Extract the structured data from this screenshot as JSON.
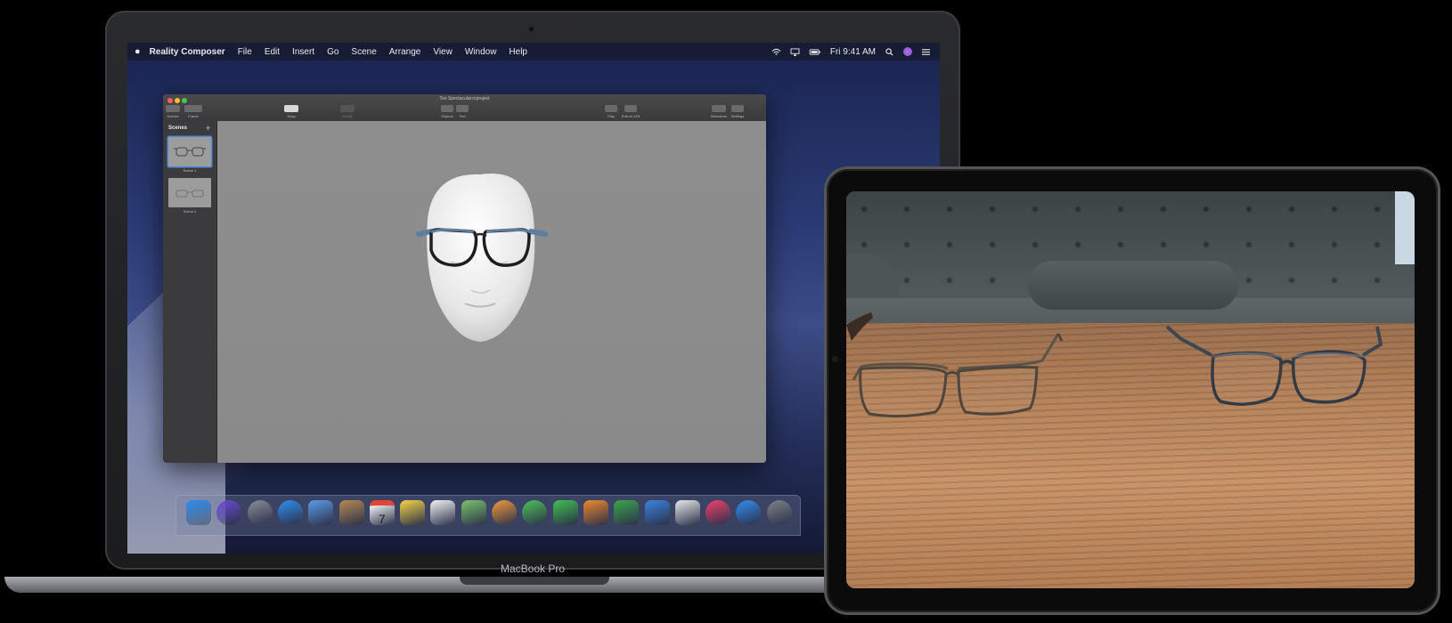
{
  "mac": {
    "brand_label": "MacBook Pro",
    "menubar": {
      "app_name": "Reality Composer",
      "menus": [
        "File",
        "Edit",
        "Insert",
        "Go",
        "Scene",
        "Arrange",
        "View",
        "Window",
        "Help"
      ],
      "clock": "Fri 9:41 AM"
    },
    "window": {
      "title": "Too Spectacular.rcproject",
      "toolbar": {
        "scenes_label": "Scenes",
        "frame_label": "Frame",
        "snap_label": "Snap",
        "modify_label": "Modify",
        "objects_label": "Objects",
        "text_label": "Text",
        "play_label": "Play",
        "edit_on_ios_label": "Edit on iOS",
        "behaviors_label": "Behaviors",
        "settings_label": "Settings"
      },
      "sidebar": {
        "title": "Scenes",
        "add_symbol": "+",
        "scenes": [
          {
            "label": "Scene 1",
            "selected": true
          },
          {
            "label": "Scene 2",
            "selected": false
          }
        ]
      }
    },
    "dock": {
      "apps": [
        {
          "icon": "finder-icon",
          "color": "#2a8cf0"
        },
        {
          "icon": "siri-icon",
          "color": "#6a4cd8"
        },
        {
          "icon": "launchpad-icon",
          "color": "#8a8f99"
        },
        {
          "icon": "safari-icon",
          "color": "#2f8ff0"
        },
        {
          "icon": "mail-icon",
          "color": "#5a9be8"
        },
        {
          "icon": "contacts-icon",
          "color": "#b88a52"
        },
        {
          "icon": "calendar-icon",
          "color": "#f2f2f2"
        },
        {
          "icon": "notes-icon",
          "color": "#f7d447"
        },
        {
          "icon": "reminders-icon",
          "color": "#f4f4f4"
        },
        {
          "icon": "maps-icon",
          "color": "#7bc46a"
        },
        {
          "icon": "photos-icon",
          "color": "#f39a3a"
        },
        {
          "icon": "messages-icon",
          "color": "#4fc25a"
        },
        {
          "icon": "facetime-icon",
          "color": "#3fbf4f"
        },
        {
          "icon": "pages-icon",
          "color": "#f08a2a"
        },
        {
          "icon": "numbers-icon",
          "color": "#3aa84a"
        },
        {
          "icon": "keynote-icon",
          "color": "#3a84e0"
        },
        {
          "icon": "reality-composer-icon",
          "color": "#e8e8e8"
        },
        {
          "icon": "music-icon",
          "color": "#f0426a"
        },
        {
          "icon": "app-store-icon",
          "color": "#2f8ff0"
        },
        {
          "icon": "system-preferences-icon",
          "color": "#7e8288"
        }
      ],
      "calendar_day": "7"
    }
  },
  "ipad": {
    "scene": "AR view of two pairs of glasses on a wooden table in front of a sofa"
  }
}
